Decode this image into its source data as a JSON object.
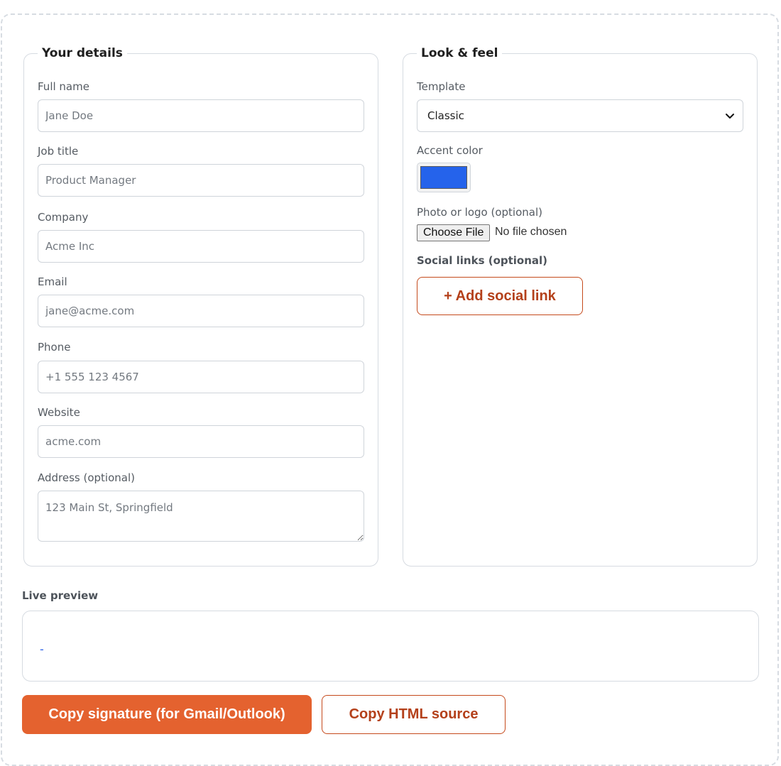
{
  "details": {
    "legend": "Your details",
    "fields": [
      {
        "label": "Full name",
        "placeholder": "Jane Doe"
      },
      {
        "label": "Job title",
        "placeholder": "Product Manager"
      },
      {
        "label": "Company",
        "placeholder": "Acme Inc"
      },
      {
        "label": "Email",
        "placeholder": "jane@acme.com"
      },
      {
        "label": "Phone",
        "placeholder": "+1 555 123 4567"
      },
      {
        "label": "Website",
        "placeholder": "acme.com"
      },
      {
        "label": "Address (optional)",
        "placeholder": "123 Main St, Springfield"
      }
    ]
  },
  "look": {
    "legend": "Look & feel",
    "template_label": "Template",
    "template_value": "Classic",
    "accent_label": "Accent color",
    "accent_color": "#2563eb",
    "photo_label": "Photo or logo (optional)",
    "choose_file": "Choose File",
    "file_status": "No file chosen",
    "social_label": "Social links (optional)",
    "add_social": "+ Add social link"
  },
  "preview": {
    "label": "Live preview",
    "content": "-"
  },
  "actions": {
    "copy_signature": "Copy signature (for Gmail/Outlook)",
    "copy_html": "Copy HTML source"
  },
  "colors": {
    "brand": "#e4622f",
    "brand_text": "#b4401a",
    "accent": "#2563eb"
  }
}
